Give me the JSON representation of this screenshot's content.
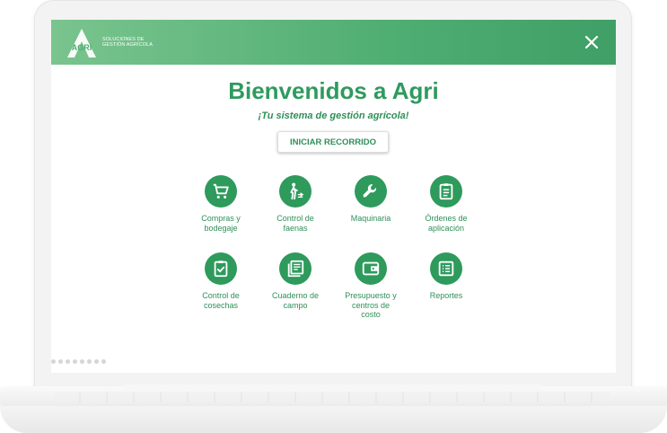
{
  "header": {
    "logo_text": "AGRI",
    "logo_line1": "SOLUCIONES DE",
    "logo_line2": "GESTIÓN AGRÍCOLA"
  },
  "main": {
    "title": "Bienvenidos a Agri",
    "subtitle": "¡Tu sistema de gestión agrícola!",
    "tour_button": "INICIAR RECORRIDO"
  },
  "modules": [
    {
      "icon": "shopping-cart-icon",
      "line1": "Compras y",
      "line2": "bodegaje",
      "line3": ""
    },
    {
      "icon": "worker-icon",
      "line1": "Control de",
      "line2": "faenas",
      "line3": ""
    },
    {
      "icon": "wrench-icon",
      "line1": "Maquinaria",
      "line2": "",
      "line3": ""
    },
    {
      "icon": "clipboard-icon",
      "line1": "Órdenes de",
      "line2": "aplicación",
      "line3": ""
    },
    {
      "icon": "checklist-icon",
      "line1": "Control de",
      "line2": "cosechas",
      "line3": ""
    },
    {
      "icon": "notebook-icon",
      "line1": "Cuaderno de",
      "line2": "campo",
      "line3": ""
    },
    {
      "icon": "wallet-icon",
      "line1": "Presupuesto y",
      "line2": "centros de",
      "line3": "costo"
    },
    {
      "icon": "report-list-icon",
      "line1": "Reportes",
      "line2": "",
      "line3": ""
    }
  ],
  "colors": {
    "brand_green": "#2e9a5c",
    "header_gradient_start": "#7ac48e",
    "header_gradient_end": "#3f9f66"
  }
}
